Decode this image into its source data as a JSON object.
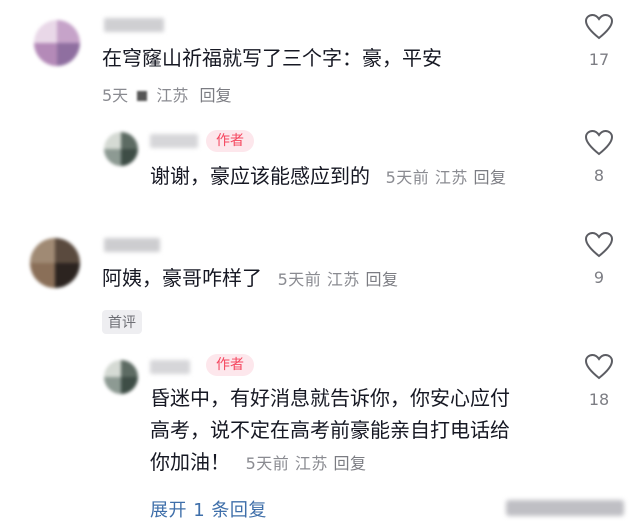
{
  "comments": [
    {
      "id": "c1",
      "text": "在穹窿山祈福就写了三个字：豪，平安",
      "meta_time": "5天",
      "meta_loc": "江苏",
      "reply": "回复",
      "likes": "17"
    },
    {
      "id": "c1r",
      "author_tag": "作者",
      "text": "谢谢，豪应该能感应到的",
      "meta_time": "5天前",
      "meta_loc": "江苏",
      "reply": "回复",
      "likes": "8"
    },
    {
      "id": "c2",
      "text": "阿姨，豪哥咋样了",
      "meta_time": "5天前",
      "meta_loc": "江苏",
      "reply": "回复",
      "likes": "9",
      "first_tag": "首评"
    },
    {
      "id": "c2r",
      "author_tag": "作者",
      "text_lines": [
        "昏迷中，有好消息就告诉你，你安心应付",
        "高考，说不定在高考前豪能亲自打电话给",
        "你加油！"
      ],
      "meta_time": "5天前",
      "meta_loc": "江苏",
      "reply": "回复",
      "likes": "18"
    }
  ],
  "expand_label": "展开 1 条回复",
  "colors": {
    "text": "#161823",
    "meta": "#8a8b91",
    "author_tag_bg": "#fde7ec",
    "author_tag_fg": "#f5475f",
    "expand_link": "#3f6faa"
  },
  "icons": {
    "like": "heart-outline-icon"
  }
}
